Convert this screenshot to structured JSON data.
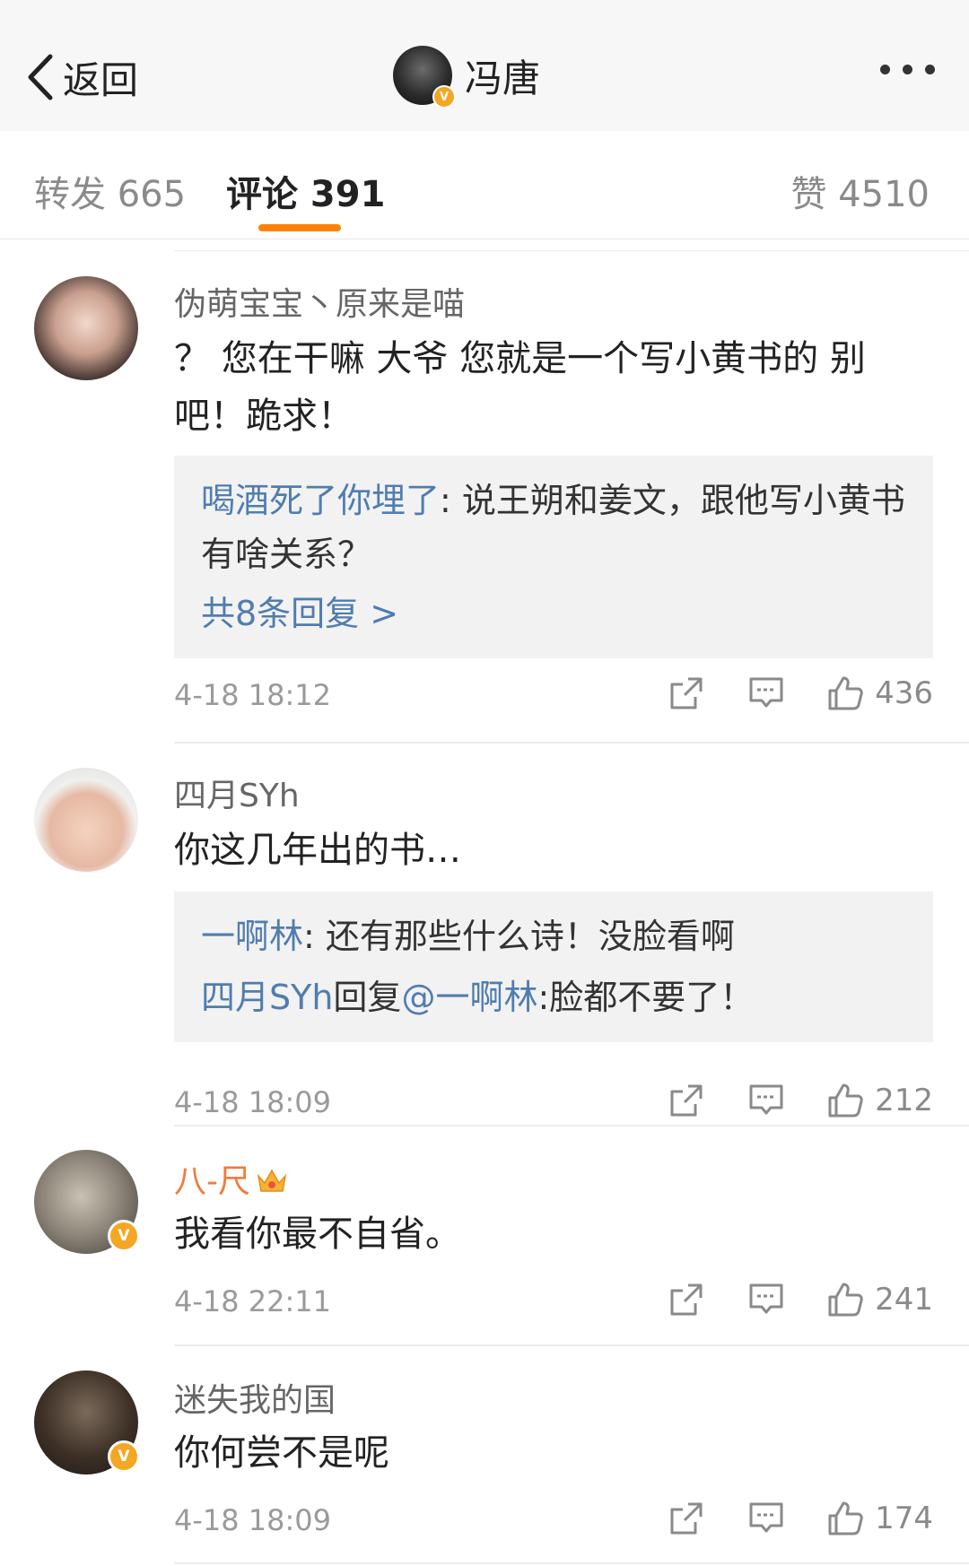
{
  "nav": {
    "back_label": "返回",
    "title": "冯唐",
    "verified": "V"
  },
  "tabs": [
    {
      "label": "转发 665"
    },
    {
      "label": "评论 391"
    },
    {
      "label": "赞 4510"
    }
  ],
  "comments": [
    {
      "user": "伪萌宝宝丶原来是喵",
      "text": "？ 您在干嘛 大爷 您就是一个写小黄书的 别吧！跪求！",
      "replies": [
        {
          "user": "喝酒死了你埋了",
          "sep": ": ",
          "text": "说王朔和姜文，跟他写小黄书有啥关系？"
        }
      ],
      "more_replies": "共8条回复 >",
      "date": "4-18 18:12",
      "likes": "436"
    },
    {
      "user": "四月SYh",
      "text": "你这几年出的书…",
      "replies": [
        {
          "user": "一啊林",
          "sep": ": ",
          "text": "还有那些什么诗！没脸看啊"
        },
        {
          "user": "四月SYh",
          "mid": "回复",
          "target": "@一啊林",
          "text": ":脸都不要了！"
        }
      ],
      "date": "4-18 18:09",
      "likes": "212"
    },
    {
      "user": "八-尺",
      "verified": "V",
      "text": "我看你最不自省。",
      "date": "4-18 22:11",
      "likes": "241"
    },
    {
      "user": "迷失我的国",
      "verified": "V",
      "text": "你何尝不是呢",
      "date": "4-18 18:09",
      "likes": "174"
    }
  ],
  "colors": {
    "accent": "#ff8200",
    "link": "#507daf",
    "vip_name": "#f27b3a",
    "verified": "#f5a623"
  },
  "icons": [
    "back-chevron-icon",
    "more-dots-icon",
    "repost-icon",
    "comment-icon",
    "like-icon",
    "crown-icon",
    "verified-icon"
  ]
}
